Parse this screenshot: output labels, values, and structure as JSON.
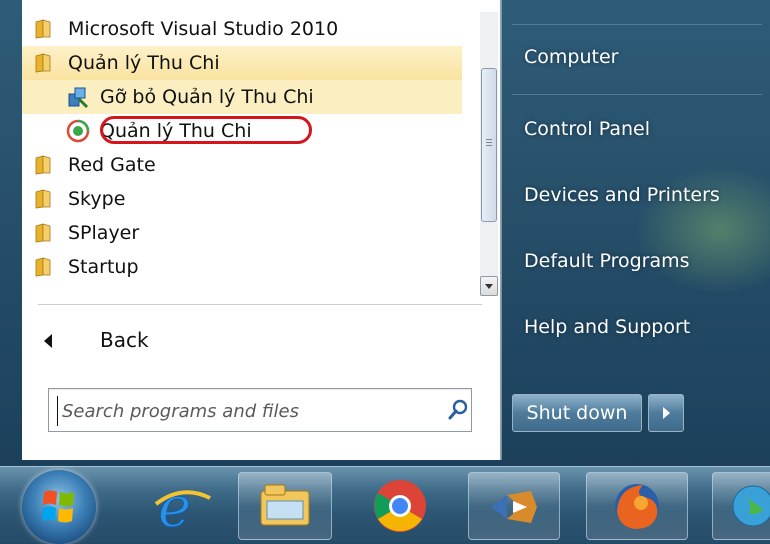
{
  "programs": [
    {
      "label": "Microsoft Visual Studio 2010",
      "type": "folder"
    },
    {
      "label": "Quản lý Thu Chi",
      "type": "folder",
      "highlight": true
    },
    {
      "label": "Gỡ bỏ Quản lý Thu Chi",
      "type": "uninstall-shortcut",
      "highlight": true
    },
    {
      "label": "Quản lý Thu Chi",
      "type": "app-shortcut",
      "circled": true
    },
    {
      "label": "Red Gate",
      "type": "folder"
    },
    {
      "label": "Skype",
      "type": "folder"
    },
    {
      "label": "SPlayer",
      "type": "folder"
    },
    {
      "label": "Startup",
      "type": "folder"
    }
  ],
  "back_label": "Back",
  "search": {
    "placeholder": "Search programs and files"
  },
  "right_pane": {
    "items": [
      "Computer",
      "Control Panel",
      "Devices and Printers",
      "Default Programs",
      "Help and Support"
    ]
  },
  "shutdown_label": "Shut down",
  "taskbar": {
    "pinned": [
      "internet-explorer-icon",
      "windows-explorer-icon",
      "chrome-icon",
      "visual-studio-icon",
      "firefox-icon",
      "network-globe-icon"
    ]
  },
  "colors": {
    "highlight": "#fbeec1",
    "circle_annotation": "#d4161c",
    "taskbar": "#2c5674"
  }
}
